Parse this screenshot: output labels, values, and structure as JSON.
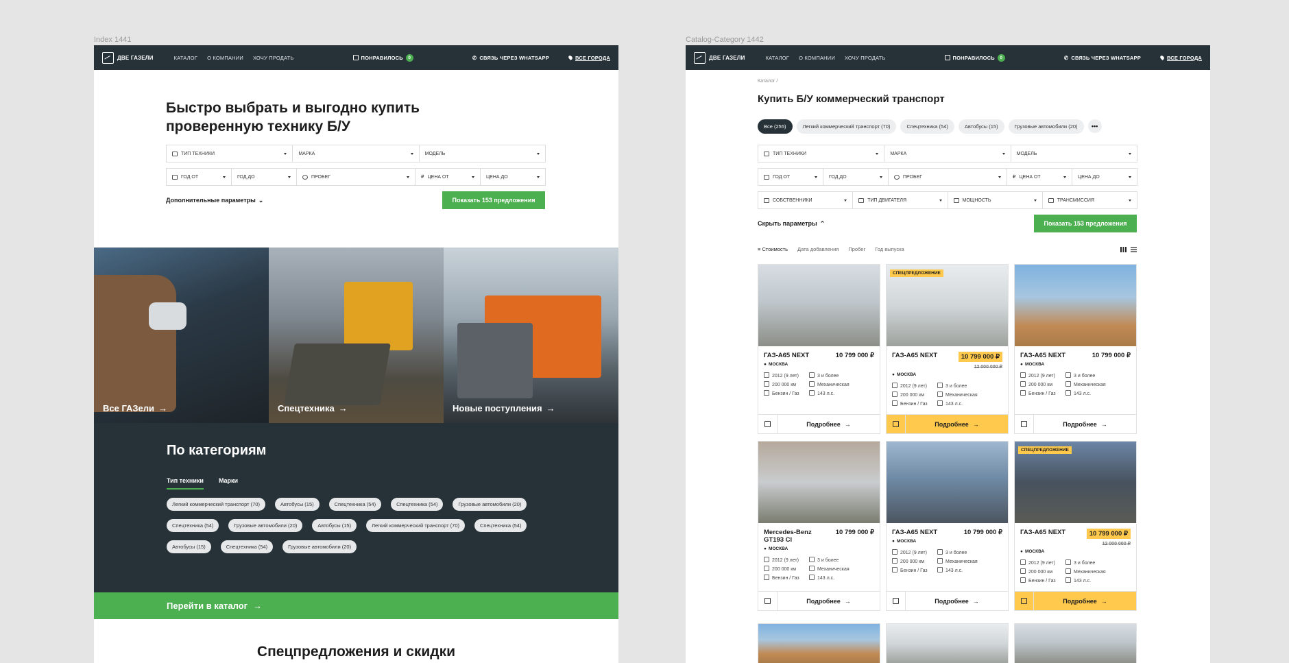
{
  "labels": {
    "index": "Index 1441",
    "catalog": "Catalog-Category 1442"
  },
  "header": {
    "logo": "ДВЕ ГАЗЕЛИ",
    "nav": [
      "КАТАЛОГ",
      "О КОМПАНИИ",
      "ХОЧУ ПРОДАТЬ"
    ],
    "liked": "ПОНРАВИЛОСЬ",
    "liked_count": "0",
    "whatsapp": "СВЯЗЬ ЧЕРЕЗ WHATSAPP",
    "city": "ВСЕ ГОРОДА"
  },
  "index": {
    "hero_title": "Быстро выбрать и выгодно купить проверенную технику Б/У",
    "filters": {
      "type": "ТИП ТЕХНИКИ",
      "brand": "МАРКА",
      "model": "МОДЕЛЬ",
      "year_from": "ГОД ОТ",
      "year_to": "ГОД ДО",
      "mileage": "ПРОБЕГ",
      "price_from": "ЦЕНА ОТ",
      "price_to": "ЦЕНА ДО"
    },
    "extra": "Дополнительные параметры",
    "show_btn": "Показать 153 предложения",
    "tiles": [
      "Все ГАЗели",
      "Спецтехника",
      "Новые поступления"
    ],
    "cats_title": "По категориям",
    "cat_tabs": [
      "Тип техники",
      "Марки"
    ],
    "chips": [
      "Легкий коммерческий транспорт (70)",
      "Автобусы (15)",
      "Спецтехника (54)",
      "Спецтехника (54)",
      "Грузовые автомобили (20)",
      "Спецтехника (54)",
      "Грузовые автомобили (20)",
      "Автобусы (15)",
      "Легкий коммерческий транспорт (70)",
      "Спецтехника (54)",
      "Автобусы (15)",
      "Спецтехника (54)",
      "Грузовые автомобили (20)"
    ],
    "go_catalog": "Перейти в каталог",
    "special": "Спецпредложения и скидки"
  },
  "catalog": {
    "crumb": "Каталог /",
    "title": "Купить Б/У коммерческий транспорт",
    "pills": [
      "Все (255)",
      "Легкий коммерческий транспорт (70)",
      "Спецтехника (54)",
      "Автобусы (15)",
      "Грузовые автомобили (20)"
    ],
    "more": "•••",
    "filters3": {
      "owners": "СОБСТВЕННИКИ",
      "engine": "ТИП ДВИГАТЕЛЯ",
      "power": "МОЩНОСТЬ",
      "trans": "ТРАНСМИССИЯ"
    },
    "hide": "Скрыть параметры",
    "sort": [
      "Стоимость",
      "Дата добавления",
      "Пробег",
      "Год выпуска"
    ],
    "cards": [
      {
        "name": "ГАЗ-А65 NEXT",
        "price": "10 799 000 ₽",
        "old": "",
        "tag": "",
        "hl": false
      },
      {
        "name": "ГАЗ-А65 NEXT",
        "price": "10 799 000 ₽",
        "old": "12 000 000 ₽",
        "tag": "СПЕЦПРЕДЛОЖЕНИЕ",
        "hl": true
      },
      {
        "name": "ГАЗ-А65 NEXT",
        "price": "10 799 000 ₽",
        "old": "",
        "tag": "",
        "hl": false
      },
      {
        "name": "Mercedes-Benz GT193 Cl",
        "price": "10 799 000 ₽",
        "old": "",
        "tag": "",
        "hl": false
      },
      {
        "name": "ГАЗ-А65 NEXT",
        "price": "10 799 000 ₽",
        "old": "",
        "tag": "",
        "hl": false
      },
      {
        "name": "ГАЗ-А65 NEXT",
        "price": "10 799 000 ₽",
        "old": "12 000 000 ₽",
        "tag": "СПЕЦПРЕДЛОЖЕНИЕ",
        "hl": true
      }
    ],
    "card_common": {
      "city": "МОСКВА",
      "year": "2012 (9 лет)",
      "owners": "3 и более",
      "km": "200 000 км",
      "gear": "Механическая",
      "fuel": "Бензин / Газ",
      "hp": "143 л.с.",
      "details": "Подробнее"
    }
  }
}
